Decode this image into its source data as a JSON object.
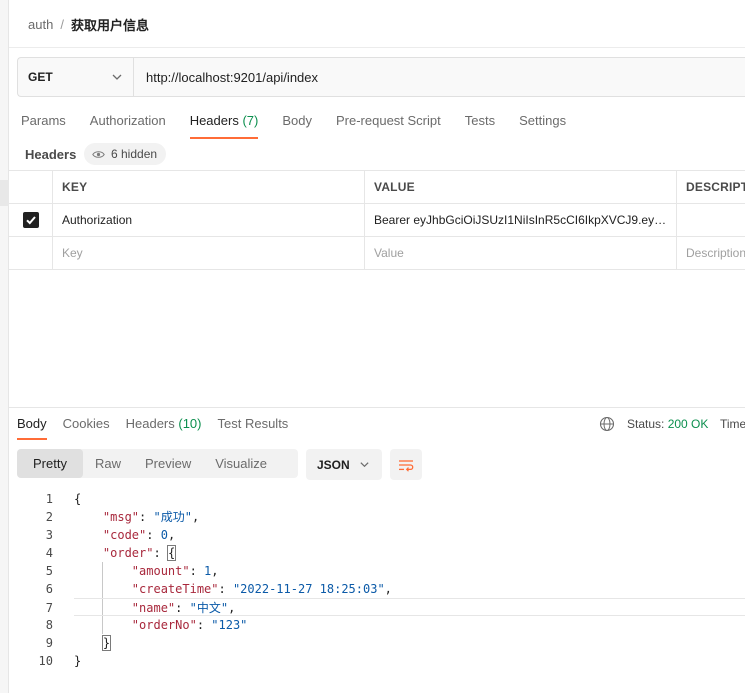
{
  "breadcrumb": {
    "parent": "auth",
    "separator": "/",
    "title": "获取用户信息"
  },
  "request": {
    "method": "GET",
    "url": "http://localhost:9201/api/index"
  },
  "request_tabs": [
    {
      "label": "Params",
      "count": ""
    },
    {
      "label": "Authorization",
      "count": ""
    },
    {
      "label": "Headers",
      "count": "(7)"
    },
    {
      "label": "Body",
      "count": ""
    },
    {
      "label": "Pre-request Script",
      "count": ""
    },
    {
      "label": "Tests",
      "count": ""
    },
    {
      "label": "Settings",
      "count": ""
    }
  ],
  "headers_section": {
    "label": "Headers",
    "hidden_badge": "6 hidden"
  },
  "table": {
    "columns": [
      "KEY",
      "VALUE",
      "DESCRIPT"
    ],
    "rows": [
      {
        "checked": true,
        "key": "Authorization",
        "value": "Bearer eyJhbGciOiJSUzI1NiIsInR5cCI6IkpXVCJ9.ey…",
        "description": ""
      }
    ],
    "placeholder": {
      "key": "Key",
      "value": "Value",
      "description": "Description"
    }
  },
  "response_tabs": [
    {
      "label": "Body",
      "count": ""
    },
    {
      "label": "Cookies",
      "count": ""
    },
    {
      "label": "Headers",
      "count": "(10)"
    },
    {
      "label": "Test Results",
      "count": ""
    }
  ],
  "status": {
    "label": "Status:",
    "code": "200 OK",
    "time_label": "Time"
  },
  "view_modes": [
    "Pretty",
    "Raw",
    "Preview",
    "Visualize"
  ],
  "format": "JSON",
  "code_lines": [
    {
      "n": "1",
      "parts": [
        [
          "p",
          "{"
        ]
      ]
    },
    {
      "n": "2",
      "parts": [
        [
          "p",
          "    "
        ],
        [
          "k",
          "\"msg\""
        ],
        [
          "p",
          ": "
        ],
        [
          "s",
          "\"成功\""
        ],
        [
          "p",
          ","
        ]
      ]
    },
    {
      "n": "3",
      "parts": [
        [
          "p",
          "    "
        ],
        [
          "k",
          "\"code\""
        ],
        [
          "p",
          ": "
        ],
        [
          "n",
          "0"
        ],
        [
          "p",
          ","
        ]
      ]
    },
    {
      "n": "4",
      "parts": [
        [
          "p",
          "    "
        ],
        [
          "k",
          "\"order\""
        ],
        [
          "p",
          ": "
        ],
        [
          "b",
          "{"
        ]
      ]
    },
    {
      "n": "5",
      "parts": [
        [
          "p",
          "        "
        ],
        [
          "k",
          "\"amount\""
        ],
        [
          "p",
          ": "
        ],
        [
          "n",
          "1"
        ],
        [
          "p",
          ","
        ]
      ]
    },
    {
      "n": "6",
      "parts": [
        [
          "p",
          "        "
        ],
        [
          "k",
          "\"createTime\""
        ],
        [
          "p",
          ": "
        ],
        [
          "s",
          "\"2022-11-27 18:25:03\""
        ],
        [
          "p",
          ","
        ]
      ]
    },
    {
      "n": "7",
      "parts": [
        [
          "p",
          "        "
        ],
        [
          "k",
          "\"name\""
        ],
        [
          "p",
          ": "
        ],
        [
          "s",
          "\"中文\""
        ],
        [
          "p",
          ","
        ]
      ]
    },
    {
      "n": "8",
      "parts": [
        [
          "p",
          "        "
        ],
        [
          "k",
          "\"orderNo\""
        ],
        [
          "p",
          ": "
        ],
        [
          "s",
          "\"123\""
        ]
      ]
    },
    {
      "n": "9",
      "parts": [
        [
          "p",
          "    "
        ],
        [
          "b",
          "}"
        ]
      ]
    },
    {
      "n": "10",
      "parts": [
        [
          "p",
          "}"
        ]
      ]
    }
  ],
  "icons": {
    "method_dropdown": "chevron-down-icon",
    "hidden_toggle": "eye-icon",
    "checkbox": "checkmark-icon",
    "network": "globe-icon",
    "format_dropdown": "chevron-down-icon",
    "wrap": "wrap-lines-icon"
  },
  "colors": {
    "accent": "#ff6c37",
    "success": "#0c8f4e",
    "json_key": "#a8283c",
    "json_string": "#0b5aa8"
  }
}
